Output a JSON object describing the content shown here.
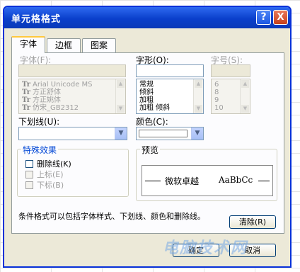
{
  "dialog": {
    "title": "单元格格式",
    "help_button": "?",
    "close_button": "X"
  },
  "tabs": [
    {
      "label": "字体"
    },
    {
      "label": "边框"
    },
    {
      "label": "图案"
    }
  ],
  "font": {
    "label": "字体(F):",
    "value": "",
    "items": [
      "Arial Unicode MS",
      "方正舒体",
      "方正姚体",
      "仿宋_GB2312"
    ],
    "item_icon": "Tr"
  },
  "style": {
    "label": "字形(O):",
    "value": "",
    "items": [
      "常规",
      "倾斜",
      "加粗",
      "加粗 倾斜"
    ]
  },
  "size": {
    "label": "字号(S):",
    "value": "",
    "items": [
      "6",
      "8",
      "9",
      "10"
    ]
  },
  "underline": {
    "label": "下划线(U):",
    "value": "",
    "dropdown_icon": "chevron-down-icon"
  },
  "color": {
    "label": "颜色(C):",
    "swatch": "#ffffff",
    "dropdown_icon": "chevron-down-icon"
  },
  "effects": {
    "title": "特殊效果",
    "items": [
      {
        "label": "删除线(K)",
        "enabled": true
      },
      {
        "label": "上标(E)",
        "enabled": false
      },
      {
        "label": "下标(B)",
        "enabled": false
      }
    ]
  },
  "preview": {
    "title": "预览",
    "text_cn": "微软卓越",
    "text_en": "AaBbCc"
  },
  "note": "条件格式可以包括字体样式、下划线、颜色和删除线。",
  "buttons": {
    "clear": "清除(R)",
    "ok": "确定",
    "cancel": "取消"
  },
  "watermark": "电脑技术网"
}
